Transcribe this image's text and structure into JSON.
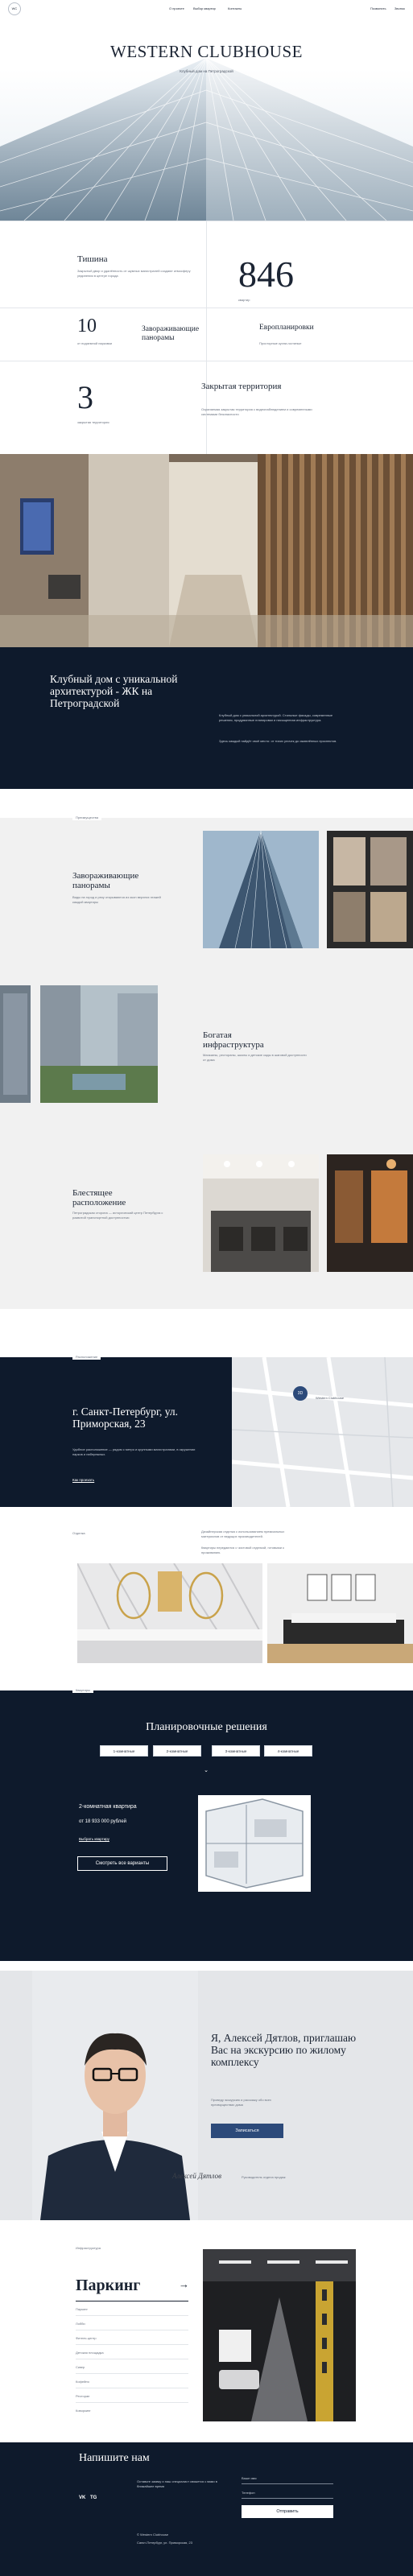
{
  "header": {
    "logo": "WC",
    "nav": [
      "О проекте",
      "Выбор квартир",
      "Контакты"
    ],
    "phone": "Позвонить",
    "callback": "Звонок"
  },
  "hero": {
    "title": "WESTERN CLUBHOUSE",
    "subtitle": "Клубный дом на Петроградской"
  },
  "stats": {
    "quiet_title": "Тишина",
    "quiet_text": "Закрытый двор и удалённость от шумных магистралей создают атмосферу уединения в центре города",
    "big_number": "846",
    "big_number_caption": "квартир",
    "ten": "10",
    "ten_caption": "от подземной парковки",
    "panorama": "Завораживающие панорамы",
    "euro": "Европланировки",
    "euro_caption": "Просторные кухни-гостиные",
    "three": "3",
    "three_caption": "закрытая территория",
    "closed_title": "Закрытая территория",
    "closed_text": "Охраняемая закрытая территория с видеонаблюдением и современными системами безопасности"
  },
  "about": {
    "title": "Клубный дом с уникальной архитектурой - ЖК на Петроградской",
    "text1": "Клубный дом с уникальной архитектурой. Стильные фасады, современные решения, продуманные планировки и насыщенная инфраструктура.",
    "text2": "Здесь каждый найдёт своё место: от тихих улочек до оживлённых проспектов."
  },
  "features": {
    "section_label": "Преимущества",
    "panorama_title": "Завораживающие панорамы",
    "panorama_text": "Виды на город и реку открываются из окон верхних этажей каждой квартиры",
    "infra_title": "Богатая инфраструктура",
    "infra_text": "Магазины, рестораны, школы и детские сады в шаговой доступности от дома",
    "location_title": "Блестящее расположение",
    "location_text": "Петроградская сторона — исторический центр Петербурга с развитой транспортной доступностью"
  },
  "location": {
    "label": "Расположение",
    "address": "г. Санкт-Петербург, ул. Приморская, 23",
    "text": "Удобное расположение — рядом с метро и крупными магистралями, в окружении парков и набережных.",
    "link": "Как проехать",
    "marker": "3D",
    "map_caption": "Western Clubhouse"
  },
  "design": {
    "label": "Отделка",
    "text1": "Дизайнерская отделка с использованием премиальных материалов от ведущих производителей.",
    "text2": "Квартиры передаются с чистовой отделкой, готовыми к проживанию."
  },
  "plans": {
    "label": "Квартиры",
    "title": "Планировочные решения",
    "tabs": [
      "1-комнатные",
      "2-комнатные",
      "3-комнатные",
      "4-комнатные"
    ],
    "apt_title": "2-комнатная квартира",
    "apt_price": "от 18 933 000 рублей",
    "apt_link": "Выбрать квартиру",
    "all_button": "Смотреть все варианты"
  },
  "manager": {
    "greeting": "Я, Алексей Дятлов, приглашаю Вас на экскурсию по жилому комплексу",
    "note": "Проведу экскурсию и расскажу обо всех преимуществах дома",
    "button": "Записаться",
    "signature": "Алексей Дятлов",
    "role": "Руководитель отдела продаж"
  },
  "parking": {
    "label": "Инфраструктура",
    "title": "Паркинг",
    "items": [
      "Паркинг",
      "Лобби",
      "Фитнес-центр",
      "Детская площадка",
      "Сквер",
      "Кофейня",
      "Ресторан",
      "Коворкинг"
    ]
  },
  "contact": {
    "title": "Напишите нам",
    "text": "Оставьте заявку и наш специалист свяжется с вами в ближайшее время",
    "social": [
      "VK",
      "TG"
    ],
    "field_name": "Ваше имя",
    "field_phone": "Телефон",
    "submit": "Отправить",
    "company": "© Western Clubhouse",
    "address": "Санкт-Петербург, ул. Приморская, 23"
  },
  "colors": {
    "navy": "#0e1a2c",
    "gray": "#f1f1f1",
    "accent": "#2c4a7a"
  }
}
